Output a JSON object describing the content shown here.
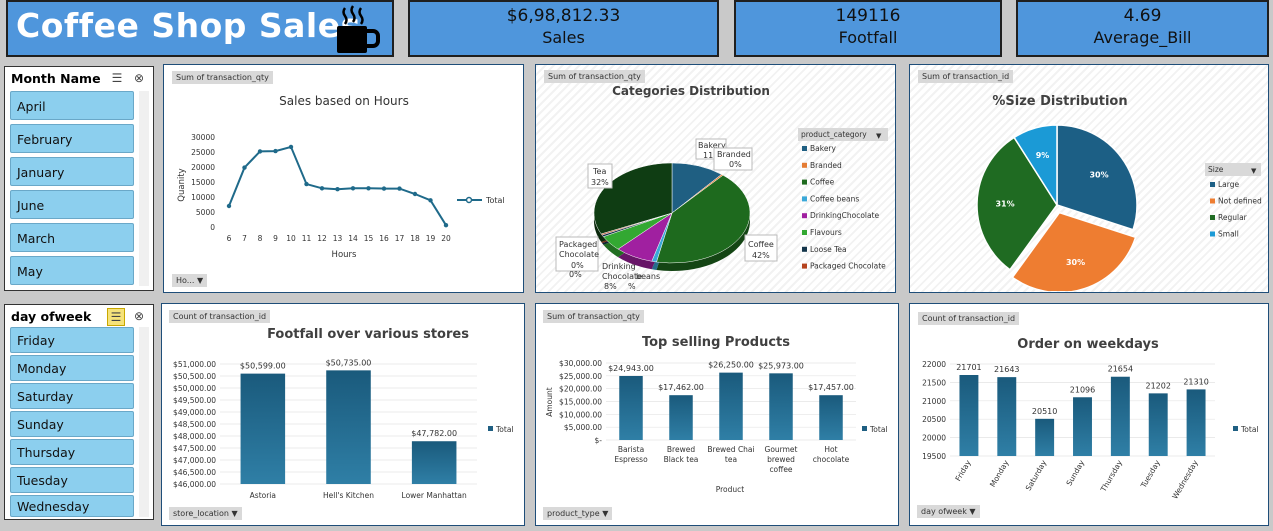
{
  "header": {
    "title": "Coffee Shop Sales",
    "icon": "coffee-cup-icon"
  },
  "kpis": [
    {
      "value": "$6,98,812.33",
      "label": "Sales"
    },
    {
      "value": "149116",
      "label": "Footfall"
    },
    {
      "value": "4.69",
      "label": "Average_Bill"
    }
  ],
  "month_slicer": {
    "title": "Month Name",
    "items": [
      "April",
      "February",
      "January",
      "June",
      "March",
      "May"
    ]
  },
  "day_slicer": {
    "title": "day ofweek",
    "items": [
      "Friday",
      "Monday",
      "Saturday",
      "Sunday",
      "Thursday",
      "Tuesday",
      "Wednesday"
    ]
  },
  "hours_chart": {
    "field_tag": "Sum of transaction_qty",
    "filter_tag": "Ho...",
    "chart_data": {
      "type": "line",
      "title": "Sales based on Hours",
      "xlabel": "Hours",
      "ylabel": "Quanity",
      "x": [
        6,
        7,
        8,
        9,
        10,
        11,
        12,
        13,
        14,
        15,
        16,
        17,
        18,
        19,
        20
      ],
      "series": [
        {
          "name": "Total",
          "values": [
            7000,
            19800,
            25200,
            25300,
            26700,
            14300,
            12900,
            12600,
            12900,
            12900,
            12800,
            12800,
            11000,
            8900,
            600
          ]
        }
      ],
      "yticks": [
        0,
        5000,
        10000,
        15000,
        20000,
        25000,
        30000
      ],
      "ylim": [
        0,
        30000
      ],
      "legend": "right",
      "color": "#1f6a8a"
    }
  },
  "categories_chart": {
    "field_tag": "Sum of transaction_qty",
    "legend_title": "product_category",
    "chart_data": {
      "type": "pie",
      "title": "Categories Distribution",
      "categories": [
        "Bakery",
        "Branded",
        "Coffee",
        "Coffee beans",
        "Drinking Chocolate",
        "Flavours",
        "Loose Tea",
        "Packaged Chocolate",
        "Tea"
      ],
      "legend_labels": [
        "Bakery",
        "Branded",
        "Coffee",
        "Coffee beans",
        "DrinkingChocolate",
        "Flavours",
        "Loose Tea",
        "Packaged Chocolate"
      ],
      "values": [
        11,
        0.4,
        42,
        1,
        8,
        5,
        0.6,
        0.4,
        32
      ],
      "colors": [
        "#1f5f82",
        "#e47c34",
        "#1e6a1e",
        "#3aa8d8",
        "#a020a0",
        "#33a832",
        "#14354a",
        "#b5431e",
        "#0f3d13"
      ],
      "labels": {
        "bakery": "Bakery",
        "bakery_pct": "11%",
        "branded": "Branded",
        "branded_pct": "0%",
        "coffee": "Coffee",
        "coffee_pct": "42%",
        "tea": "Tea",
        "tea_pct": "32%",
        "packaged": "Packaged",
        "packaged2": "Chocolate",
        "packaged_pct": "0%",
        "drinking": "Drinking",
        "drinking2": "Chocolate",
        "drinking_pct": "8%",
        "beans": "beans",
        "beans_pct": "%",
        "zero_pct": "0%"
      },
      "legend": "right"
    }
  },
  "size_chart": {
    "field_tag": "Sum of transaction_id",
    "legend_title": "Size",
    "chart_data": {
      "type": "pie",
      "title": "%Size Distribution",
      "categories": [
        "Large",
        "Not defined",
        "Regular",
        "Small"
      ],
      "values": [
        30,
        30,
        31,
        9
      ],
      "labels": [
        "30%",
        "30%",
        "31%",
        "9%"
      ],
      "colors": [
        "#1c5f85",
        "#ee7d31",
        "#1f6b22",
        "#1b9ad6"
      ],
      "legend": "right"
    }
  },
  "stores_chart": {
    "field_tag": "Count of transaction_id",
    "filter_tag": "store_location",
    "chart_data": {
      "type": "bar",
      "title": "Footfall over various stores",
      "categories": [
        "Astoria",
        "Hell's Kitchen",
        "Lower Manhattan"
      ],
      "values": [
        50599,
        50735,
        47782
      ],
      "data_labels": [
        "$50,599.00",
        "$50,735.00",
        "$47,782.00"
      ],
      "ylim": [
        46000,
        51000
      ],
      "yticks": [
        "$46,000.00",
        "$46,500.00",
        "$47,000.00",
        "$47,500.00",
        "$48,000.00",
        "$48,500.00",
        "$49,000.00",
        "$49,500.00",
        "$50,000.00",
        "$50,500.00",
        "$51,000.00"
      ],
      "series_name": "Total",
      "legend": "right"
    }
  },
  "products_chart": {
    "field_tag": "Sum of transaction_qty",
    "filter_tag": "product_type",
    "chart_data": {
      "type": "bar",
      "title": "Top selling Products",
      "xlabel": "Product",
      "ylabel": "Amount",
      "categories": [
        [
          "Barista",
          "Espresso"
        ],
        [
          "Brewed",
          "Black tea"
        ],
        [
          "Brewed Chai",
          "tea"
        ],
        [
          "Gourmet",
          "brewed",
          "coffee"
        ],
        [
          "Hot",
          "chocolate"
        ]
      ],
      "values": [
        24943,
        17462,
        26250,
        25973,
        17457
      ],
      "data_labels": [
        "$24,943.00",
        "$17,462.00",
        "$26,250.00",
        "$25,973.00",
        "$17,457.00"
      ],
      "ylim": [
        0,
        30000
      ],
      "yticks": [
        "$-",
        "$5,000.00",
        "$10,000.00",
        "$15,000.00",
        "$20,000.00",
        "$25,000.00",
        "$30,000.00"
      ],
      "series_name": "Total",
      "legend": "right"
    }
  },
  "weekdays_chart": {
    "field_tag": "Count of transaction_id",
    "filter_tag": "day ofweek",
    "chart_data": {
      "type": "bar",
      "title": "Order on weekdays",
      "categories": [
        "Friday",
        "Monday",
        "Saturday",
        "Sunday",
        "Thursday",
        "Tuesday",
        "Wednesday"
      ],
      "values": [
        21701,
        21643,
        20510,
        21096,
        21654,
        21202,
        21310
      ],
      "data_labels": [
        "21701",
        "21643",
        "20510",
        "21096",
        "21654",
        "21202",
        "21310"
      ],
      "ylim": [
        19500,
        22000
      ],
      "yticks": [
        "19500",
        "20000",
        "20500",
        "21000",
        "21500",
        "22000"
      ],
      "series_name": "Total",
      "legend": "right"
    }
  }
}
